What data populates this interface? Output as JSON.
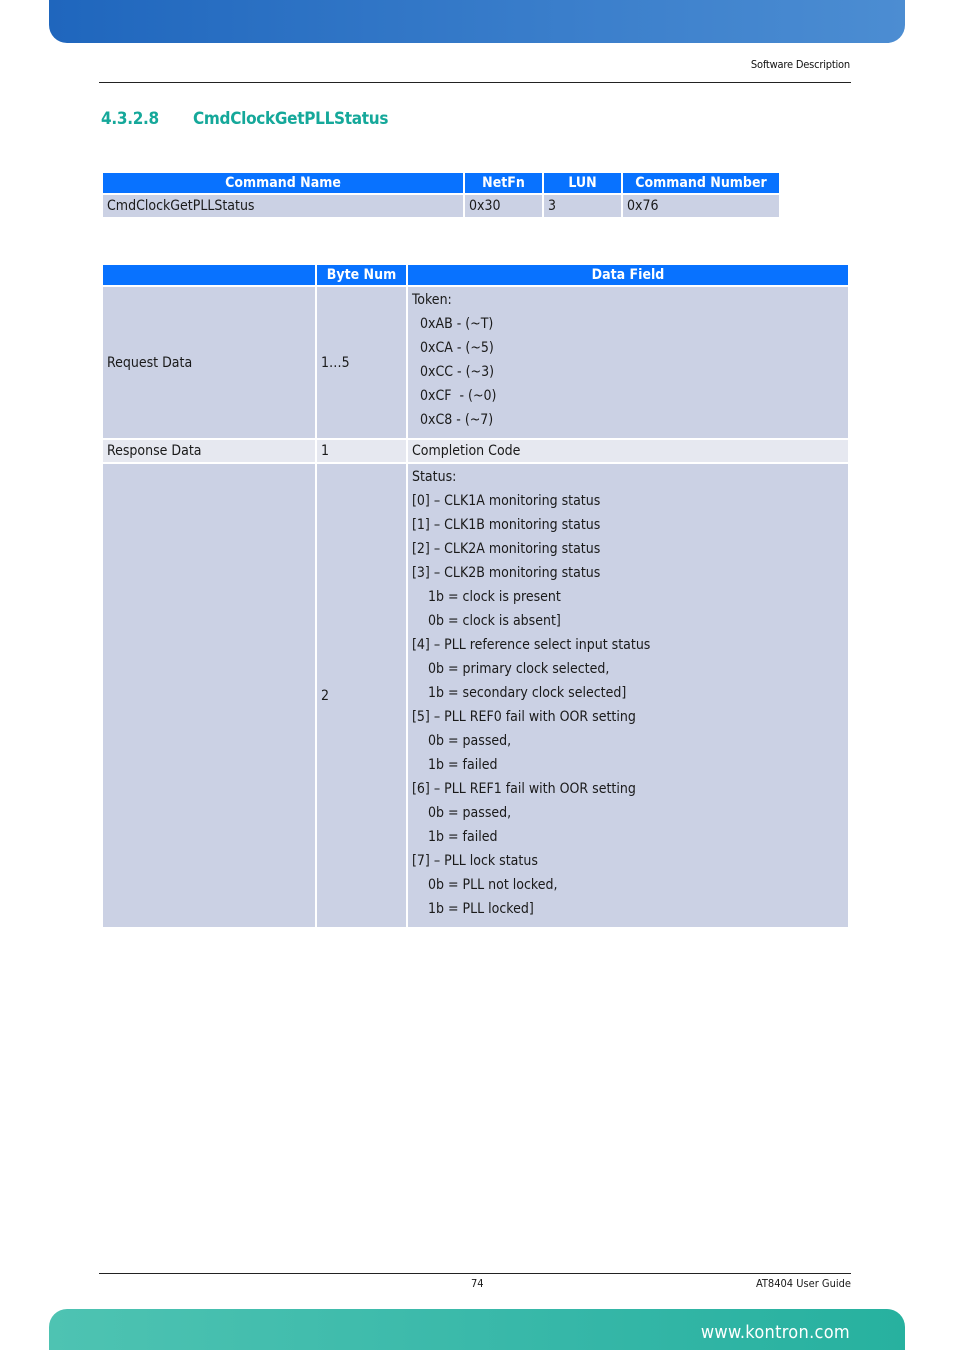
{
  "header": {
    "section": "Software Description"
  },
  "title": {
    "number": "4.3.2.8",
    "text": "CmdClockGetPLLStatus"
  },
  "command_table": {
    "headers": [
      "Command Name",
      "NetFn",
      "LUN",
      "Command Number"
    ],
    "row": [
      "CmdClockGetPLLStatus",
      "0x30",
      "3",
      "0x76"
    ]
  },
  "data_table": {
    "headers": [
      "",
      "Byte Num",
      "Data Field"
    ],
    "rows": [
      {
        "label": "Request Data",
        "byte": "1…5",
        "lines": [
          "Token:",
          "  0xAB - (~T)",
          "  0xCA - (~5)",
          "  0xCC - (~3)",
          "  0xCF  - (~0)",
          "  0xC8 - (~7)"
        ]
      },
      {
        "label": "Response Data",
        "byte": "1",
        "lines": [
          "Completion Code"
        ]
      },
      {
        "label": "",
        "byte": "2",
        "lines": [
          "Status:",
          "[0] – CLK1A monitoring status",
          "[1] – CLK1B monitoring status",
          "[2] – CLK2A monitoring status",
          "[3] – CLK2B monitoring status",
          "    1b = clock is present",
          "    0b = clock is absent]",
          "[4] – PLL reference select input status",
          "    0b = primary clock selected,",
          "    1b = secondary clock selected]",
          "[5] – PLL REF0 fail with OOR setting",
          "    0b = passed,",
          "    1b = failed",
          "[6] – PLL REF1 fail with OOR setting",
          "    0b = passed,",
          "    1b = failed",
          "[7] – PLL lock status",
          "    0b = PLL not locked,",
          "    1b = PLL locked]"
        ]
      }
    ]
  },
  "footer": {
    "page": "74",
    "doc": "AT8404 User  Guide",
    "url": "www.kontron.com"
  }
}
